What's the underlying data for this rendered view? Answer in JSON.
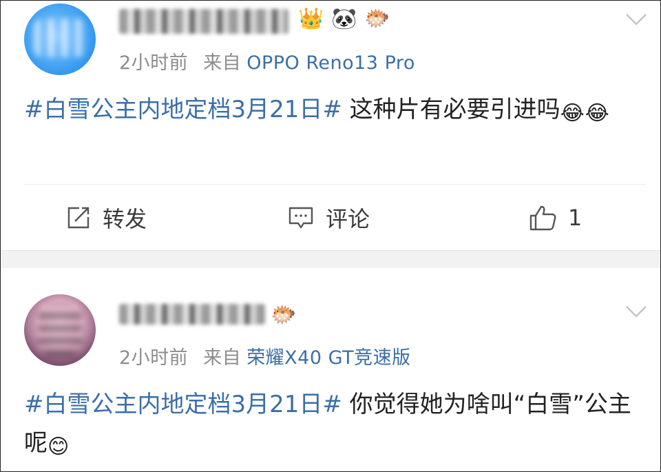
{
  "posts": [
    {
      "meta": {
        "time": "2小时前",
        "source_label": "来自",
        "source": "OPPO Reno13 Pro"
      },
      "badges": [
        "crown-icon",
        "panda-icon",
        "fish-icon"
      ],
      "content": {
        "hashtag": "#白雪公主内地定档3月21日#",
        "text": " 这种片有必要引进吗",
        "emojis": [
          "😂",
          "😂"
        ]
      },
      "actions": {
        "repost": "转发",
        "comment": "评论",
        "like": "1"
      }
    },
    {
      "meta": {
        "time": "2小时前",
        "source_label": "来自",
        "source": "荣耀X40 GT竞速版"
      },
      "badges": [
        "fish-icon"
      ],
      "content": {
        "hashtag": "#白雪公主内地定档3月21日#",
        "text": " 你觉得她为啥叫“白雪”公主呢",
        "emojis": [
          "😊"
        ]
      }
    }
  ],
  "colors": {
    "link": "#3a6ea8",
    "meta": "#8c8c8c",
    "text": "#222222",
    "separator": "#f2f2f2"
  }
}
